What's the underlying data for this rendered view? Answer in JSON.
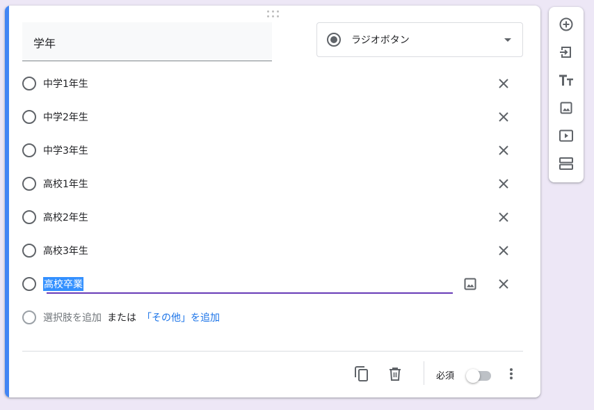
{
  "question": {
    "title": "学年",
    "type_label": "ラジオボタン"
  },
  "options": [
    {
      "label": "中学1年生"
    },
    {
      "label": "中学2年生"
    },
    {
      "label": "中学3年生"
    },
    {
      "label": "高校1年生"
    },
    {
      "label": "高校2年生"
    },
    {
      "label": "高校3年生"
    },
    {
      "label": "高校卒業",
      "selected": true
    }
  ],
  "add_option": {
    "add_label": "選択肢を追加",
    "or_label": "または",
    "other_label": "「その他」を追加"
  },
  "footer": {
    "required_label": "必須",
    "required_on": false
  },
  "colors": {
    "accent": "#4285f4",
    "underline": "#673ab7",
    "link": "#1a73e8",
    "background": "#ede7f6"
  },
  "icons": {
    "side": [
      "add-circle-icon",
      "import-icon",
      "title-icon",
      "image-icon",
      "video-icon",
      "section-icon"
    ],
    "footer": [
      "copy-icon",
      "delete-icon",
      "more-vert-icon"
    ]
  }
}
